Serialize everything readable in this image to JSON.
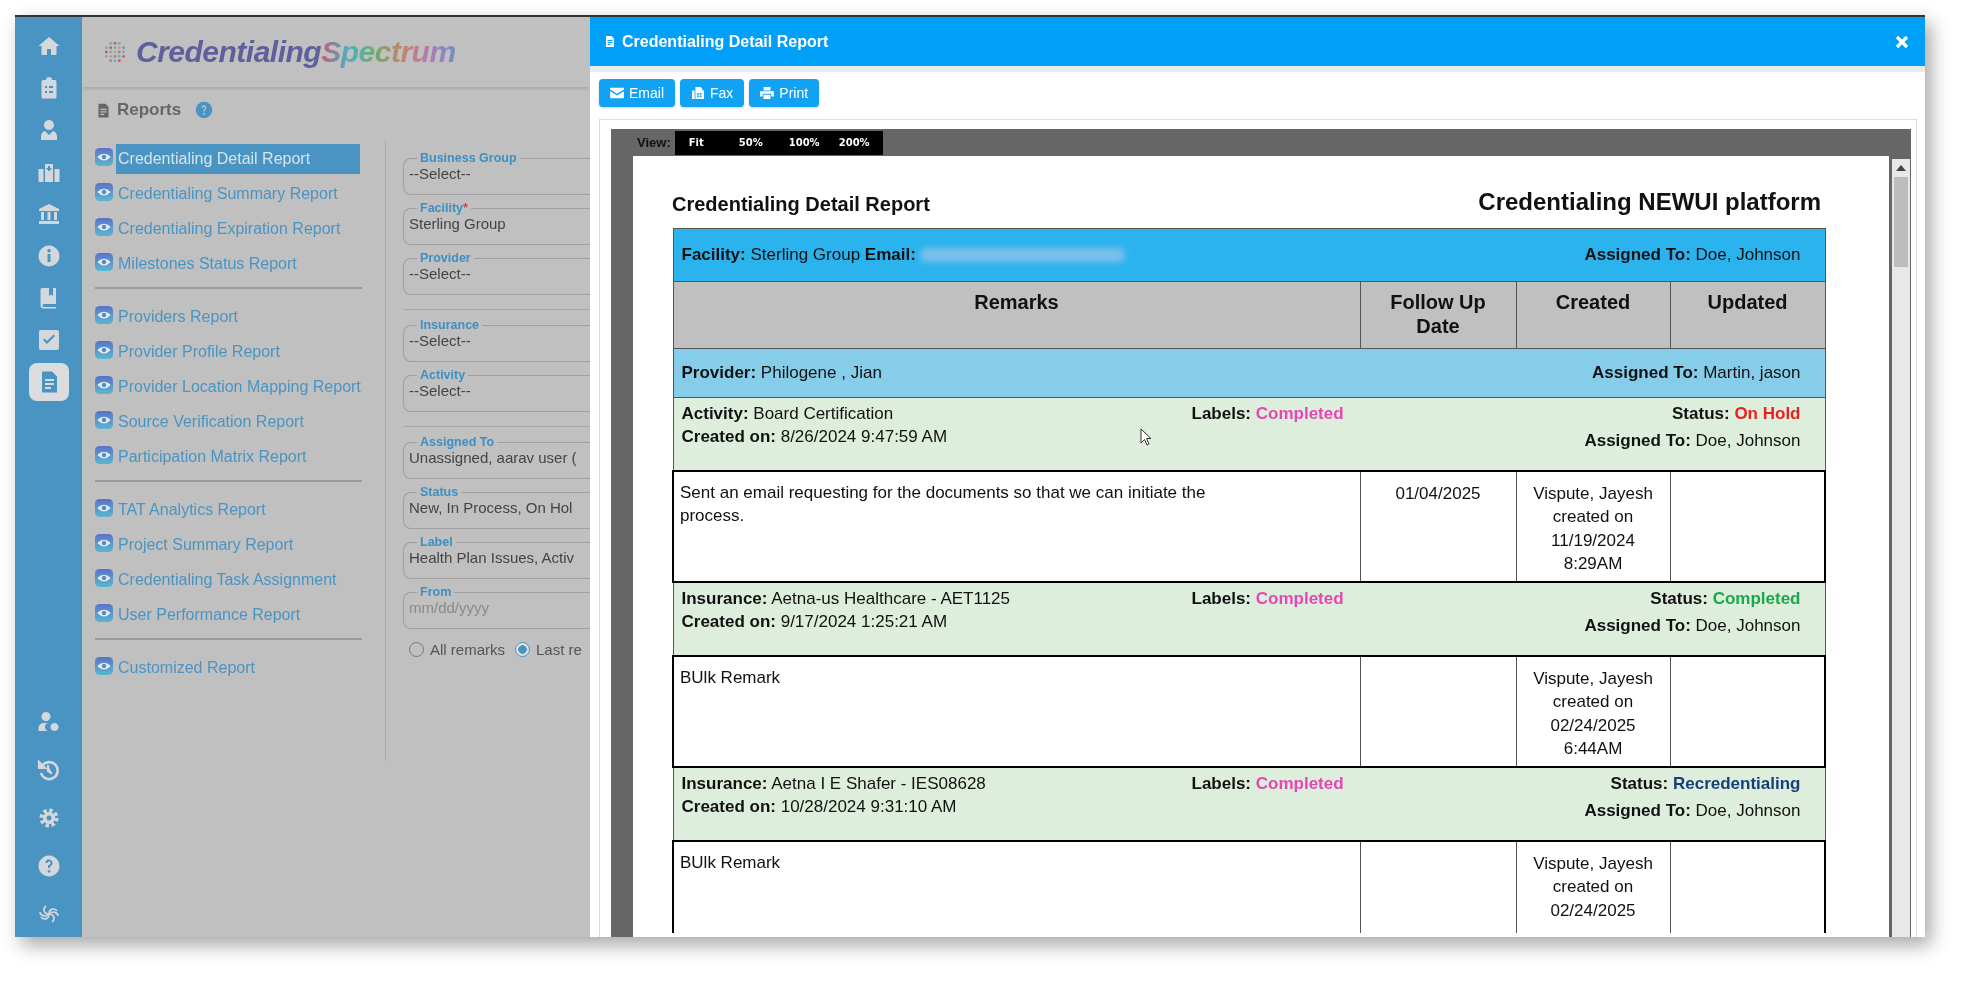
{
  "app": {
    "logo": {
      "first": "Credentialing",
      "second": "Spectrum"
    }
  },
  "sidebar": {
    "items": [
      {
        "kind": "home",
        "selected": false
      },
      {
        "kind": "clipboard",
        "selected": false
      },
      {
        "kind": "doctor",
        "selected": false
      },
      {
        "kind": "hospital",
        "selected": false
      },
      {
        "kind": "bank",
        "selected": false
      },
      {
        "kind": "info",
        "selected": false
      },
      {
        "kind": "book",
        "selected": false
      },
      {
        "kind": "checkbox",
        "selected": false
      },
      {
        "kind": "reports",
        "selected": true
      }
    ],
    "bottom_items": [
      {
        "kind": "user-settings",
        "selected": false
      },
      {
        "kind": "history",
        "selected": false
      },
      {
        "kind": "settings",
        "selected": false
      },
      {
        "kind": "help",
        "selected": false
      },
      {
        "kind": "spiral",
        "selected": false
      }
    ]
  },
  "page": {
    "title": "Reports"
  },
  "report_menu": {
    "groups": [
      {
        "items": [
          {
            "label": "Credentialing Detail Report",
            "selected": true
          },
          {
            "label": "Credentialing Summary Report",
            "selected": false
          },
          {
            "label": "Credentialing Expiration Report",
            "selected": false
          },
          {
            "label": "Milestones Status Report",
            "selected": false
          }
        ]
      },
      {
        "items": [
          {
            "label": "Providers Report",
            "selected": false
          },
          {
            "label": "Provider Profile Report",
            "selected": false
          },
          {
            "label": "Provider Location Mapping Report",
            "selected": false
          },
          {
            "label": "Source Verification Report",
            "selected": false
          },
          {
            "label": "Participation Matrix Report",
            "selected": false
          }
        ]
      },
      {
        "items": [
          {
            "label": "TAT Analytics Report",
            "selected": false
          },
          {
            "label": "Project Summary Report",
            "selected": false
          },
          {
            "label": "Credentialing Task Assignment",
            "selected": false
          },
          {
            "label": "User Performance Report",
            "selected": false
          }
        ]
      },
      {
        "items": [
          {
            "label": "Customized Report",
            "selected": false
          }
        ]
      }
    ]
  },
  "filters": {
    "groups": [
      {
        "fields": [
          {
            "label": "Business Group",
            "value": "--Select--",
            "required": false
          },
          {
            "label": "Facility",
            "value": "Sterling Group",
            "required": true
          },
          {
            "label": "Provider",
            "value": "--Select--",
            "required": false
          }
        ]
      },
      {
        "fields": [
          {
            "label": "Insurance",
            "value": "--Select--",
            "required": false
          },
          {
            "label": "Activity",
            "value": "--Select--",
            "required": false
          }
        ]
      },
      {
        "fields": [
          {
            "label": "Assigned To",
            "value": "Unassigned, aarav user (",
            "required": false
          },
          {
            "label": "Status",
            "value": "New, In Process, On Hol",
            "required": false
          },
          {
            "label": "Label",
            "value": "Health Plan Issues, Activ",
            "required": false
          },
          {
            "label": "From",
            "placeholder": "mm/dd/yyyy",
            "required": false
          }
        ]
      }
    ],
    "required_mark": "*",
    "radios": [
      {
        "label": "All remarks",
        "selected": false
      },
      {
        "label": "Last re",
        "selected": true
      }
    ]
  },
  "modal": {
    "title": "Credentialing Detail Report",
    "buttons": [
      {
        "kind": "email",
        "label": "Email"
      },
      {
        "kind": "fax",
        "label": "Fax"
      },
      {
        "kind": "print",
        "label": "Print"
      }
    ],
    "viewer": {
      "view_label": "View:",
      "zoom_options": [
        "Fit",
        "50%",
        "100%",
        "200%"
      ]
    },
    "report": {
      "title": "Credentialing Detail Report",
      "organization": "Credentialing NEWUI platform",
      "facility_row": {
        "facility": "**Facility:** Sterling Group **Email:**",
        "assigned": "**Assigned To:** Doe, Johnson"
      },
      "columns": [
        "Remarks",
        "Follow Up Date",
        "Created",
        "Updated"
      ],
      "provider_row": {
        "provider": "**Provider:** Philogene , Jian",
        "assigned": "**Assigned To:** Martin, jason"
      },
      "entries": [
        {
          "subject": "**Activity:** Board Certification",
          "created_on": "**Created on:** 8/26/2024 9:47:59 AM",
          "labels": {
            "label": "Labels:",
            "value": "Completed"
          },
          "status": {
            "label": "Status:",
            "value": "On Hold",
            "color": "#e8211d"
          },
          "assigned": "**Assigned To:** Doe, Johnson",
          "remark": {
            "text": "Sent an email requesting for the documents so that we can initiate the process.",
            "follow_up": "01/04/2025",
            "created": "Vispute, Jayesh created on 11/19/2024 8:29AM"
          }
        },
        {
          "subject": "**Insurance:** Aetna-us Healthcare - AET1125",
          "created_on": "**Created on:** 9/17/2024 1:25:21 AM",
          "labels": {
            "label": "Labels:",
            "value": "Completed"
          },
          "status": {
            "label": "Status:",
            "value": "Completed",
            "color": "#1aa84a"
          },
          "assigned": "**Assigned To:** Doe, Johnson",
          "remark": {
            "text": "BUlk Remark",
            "created": "Vispute, Jayesh created on 02/24/2025 6:44AM"
          }
        },
        {
          "subject": "**Insurance:** Aetna I E Shafer - IES08628",
          "created_on": "**Created on:** 10/28/2024 9:31:10 AM",
          "labels": {
            "label": "Labels:",
            "value": "Completed"
          },
          "status": {
            "label": "Status:",
            "value": "Recredentialing",
            "color": "#173f7a"
          },
          "assigned": "**Assigned To:** Doe, Johnson",
          "remark": {
            "text": "BUlk Remark",
            "created": "Vispute, Jayesh created on 02/24/2025"
          }
        }
      ]
    }
  }
}
